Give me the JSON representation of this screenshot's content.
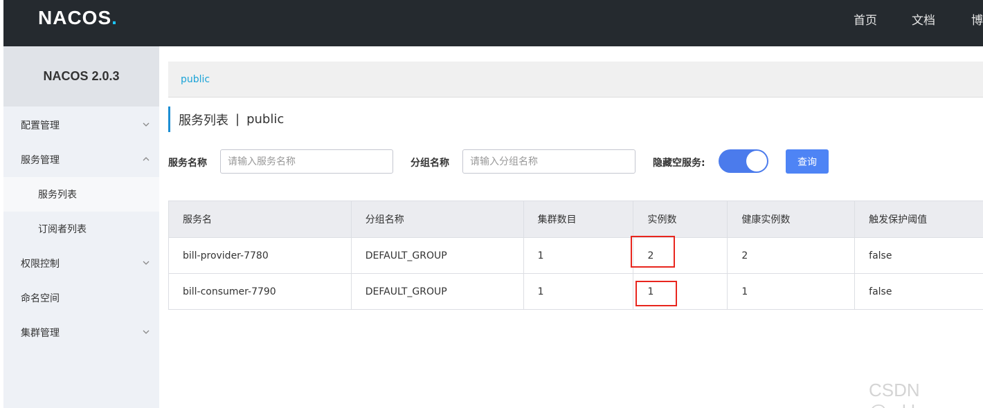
{
  "header": {
    "logo": "NACOS",
    "logo_dot": ".",
    "nav": [
      "首页",
      "文档",
      "博"
    ]
  },
  "sidebar": {
    "brand": "NACOS 2.0.3",
    "items": [
      {
        "label": "配置管理",
        "icon": "chevron-down"
      },
      {
        "label": "服务管理",
        "icon": "chevron-up"
      },
      {
        "label": "服务列表"
      },
      {
        "label": "订阅者列表"
      },
      {
        "label": "权限控制",
        "icon": "chevron-down"
      },
      {
        "label": "命名空间"
      },
      {
        "label": "集群管理",
        "icon": "chevron-down"
      }
    ]
  },
  "breadcrumb": "public",
  "page_title": {
    "main": "服务列表",
    "sep": "|",
    "namespace": "public"
  },
  "filters": {
    "service_name_label": "服务名称",
    "service_name_placeholder": "请输入服务名称",
    "group_name_label": "分组名称",
    "group_name_placeholder": "请输入分组名称",
    "hide_empty_label": "隐藏空服务:",
    "hide_empty_on": true,
    "query_label": "查询"
  },
  "table": {
    "headers": [
      "服务名",
      "分组名称",
      "集群数目",
      "实例数",
      "健康实例数",
      "触发保护阈值"
    ],
    "rows": [
      [
        "bill-provider-7780",
        "DEFAULT_GROUP",
        "1",
        "2",
        "2",
        "false"
      ],
      [
        "bill-consumer-7790",
        "DEFAULT_GROUP",
        "1",
        "1",
        "1",
        "false"
      ]
    ]
  },
  "watermark": "CSDN @xrkhy",
  "colors": {
    "accent": "#4e84f5",
    "highlight": "#e8251d",
    "topbar": "#252a2f"
  }
}
